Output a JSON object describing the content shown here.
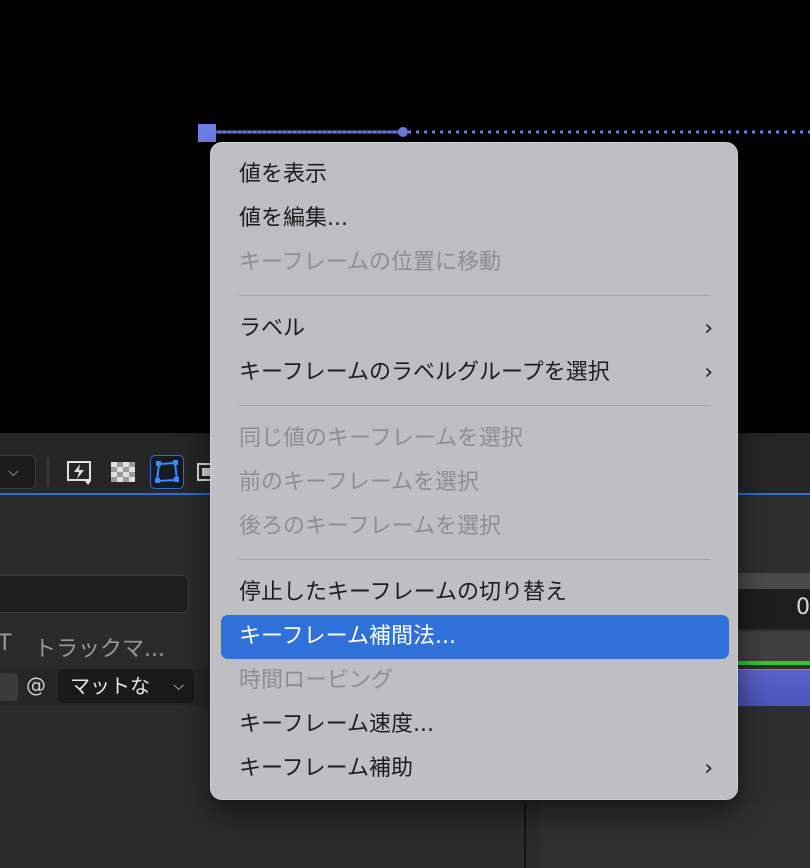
{
  "context_menu": {
    "items": [
      {
        "label": "値を表示",
        "enabled": true
      },
      {
        "label": "値を編集...",
        "enabled": true
      },
      {
        "label": "キーフレームの位置に移動",
        "enabled": false
      },
      {
        "label": "ラベル",
        "enabled": true,
        "submenu": true
      },
      {
        "label": "キーフレームのラベルグループを選択",
        "enabled": true,
        "submenu": true
      },
      {
        "label": "同じ値のキーフレームを選択",
        "enabled": false
      },
      {
        "label": "前のキーフレームを選択",
        "enabled": false
      },
      {
        "label": "後ろのキーフレームを選択",
        "enabled": false
      },
      {
        "label": "停止したキーフレームの切り替え",
        "enabled": true
      },
      {
        "label": "キーフレーム補間法...",
        "enabled": true,
        "highlighted": true
      },
      {
        "label": "時間ロービング",
        "enabled": false
      },
      {
        "label": "キーフレーム速度...",
        "enabled": true
      },
      {
        "label": "キーフレーム補助",
        "enabled": true,
        "submenu": true
      }
    ],
    "submenu_arrow": "›"
  },
  "layer_panel": {
    "column_t": "T",
    "column_track_matte": "トラックマ...",
    "matte_select_value": "マットな",
    "spiral_icon_glyph": "@"
  },
  "timeline": {
    "time_readout": "0"
  },
  "icons": {
    "chevron_down": "⌵"
  },
  "colors": {
    "accent": "#2f71d8",
    "path": "#6f7ee6",
    "layer_bar": "#5a63c7",
    "green_bar": "#27c93f"
  }
}
